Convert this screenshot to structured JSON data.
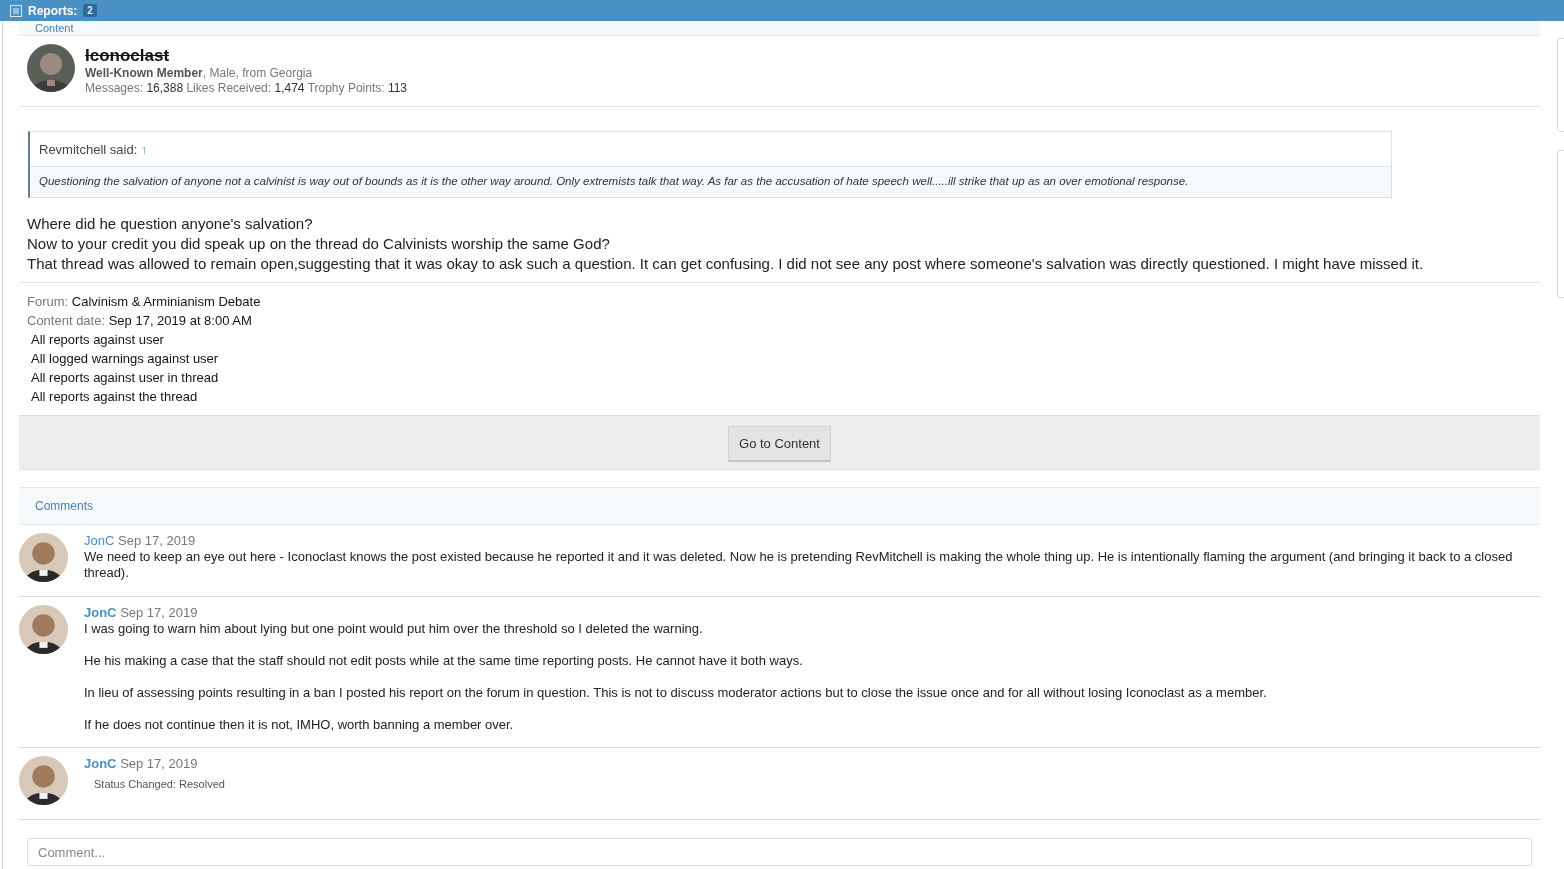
{
  "top_bar": {
    "title": "Reports:",
    "count": "2"
  },
  "content_section": {
    "title": "Content",
    "author": {
      "name": "Iconoclast",
      "struck": true,
      "title": "Well-Known Member",
      "details": ", Male, from Georgia",
      "stats": [
        {
          "label": "Messages:",
          "value": "16,388"
        },
        {
          "label": "Likes Received:",
          "value": "1,474"
        },
        {
          "label": "Trophy Points:",
          "value": "113"
        }
      ]
    },
    "quote": {
      "attribution": "Revmitchell said:",
      "arrow": "↑",
      "text": "Questioning the salvation of anyone not a calvinist is way out of bounds as it is the other way around. Only extremists talk that way. As far as the accusation of hate speech well.....ill strike that up as an over emotional response."
    },
    "body": [
      "Where did he question anyone's salvation?",
      "Now to your credit you did speak up on the thread do Calvinists worship the same God?",
      "That thread was allowed to remain open,suggesting that it was okay to ask such a question. It can get confusing. I did not see any post where someone's salvation was directly questioned. I might have missed it."
    ],
    "meta": [
      {
        "label": "Forum:",
        "value": "Calvinism & Arminianism Debate"
      },
      {
        "label": "Content date:",
        "value": "Sep 17, 2019 at 8:00 AM"
      }
    ],
    "links": [
      "All reports against user",
      "All logged warnings against user",
      "All reports against user in thread",
      "All reports against the thread"
    ],
    "button": "Go to Content"
  },
  "comments_section": {
    "title": "Comments",
    "comments": [
      {
        "kind": "message",
        "author": "JonC",
        "bold": false,
        "date": "Sep 17, 2019",
        "paragraphs": [
          "We need to keep an eye out here - Iconoclast knows the post existed because he reported it and it was deleted. Now he is pretending RevMitchell is making the whole thing up. He is intentionally flaming the argument (and bringing it back to a closed thread)."
        ]
      },
      {
        "kind": "message",
        "author": "JonC",
        "bold": true,
        "date": "Sep 17, 2019",
        "paragraphs": [
          "I was going to warn him about lying but one point would put him over the threshold so I deleted the warning.",
          "He his making a case that the staff should not edit posts while at the same time reporting posts. He cannot have it both ways.",
          "In lieu of assessing points resulting in a ban I posted his report on the forum in question. This is not to discuss moderator actions but to close the issue once and for all without losing Iconoclast as a member.",
          "If he does not continue then it is not, IMHO, worth banning a member over."
        ]
      },
      {
        "kind": "status",
        "author": "JonC",
        "bold": true,
        "date": "Sep 17, 2019",
        "paragraphs": [
          "Status Changed: Resolved"
        ]
      }
    ],
    "comment_field": {
      "placeholder": "Comment..."
    }
  }
}
